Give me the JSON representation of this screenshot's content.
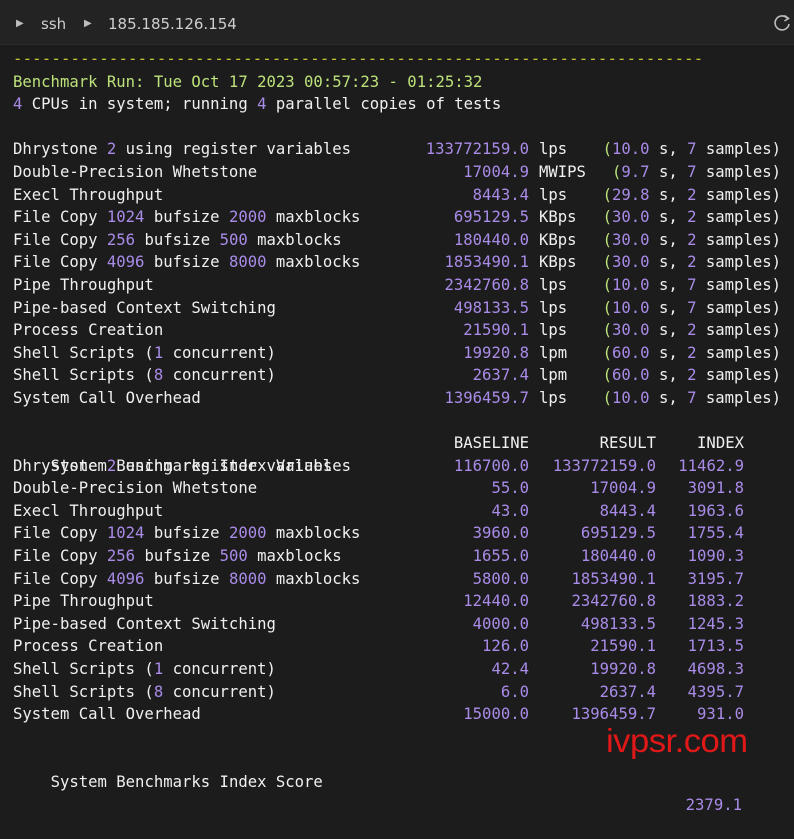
{
  "titlebar": {
    "session": "ssh",
    "host": "185.185.126.154"
  },
  "separator": "------------------------------------------------------------------------",
  "run": {
    "label": "Benchmark Run: ",
    "date": "Tue Oct 17 2023 00:57:23 - 01:25:32",
    "cpu_count": "4",
    "cpu_text_a": " CPUs in system; running ",
    "copies": "4",
    "cpu_text_b": " parallel copies of tests"
  },
  "results": [
    {
      "name_a": "Dhrystone ",
      "n1": "2",
      "name_b": " using register variables",
      "value": "133772159.0",
      "unit": "lps",
      "time": "10.0",
      "tunit": "s",
      "samples": "7"
    },
    {
      "name_a": "Double-Precision Whetstone",
      "n1": "",
      "name_b": "",
      "value": "17004.9",
      "unit": "MWIPS",
      "time": "9.7",
      "tunit": "s",
      "samples": "7"
    },
    {
      "name_a": "Execl Throughput",
      "n1": "",
      "name_b": "",
      "value": "8443.4",
      "unit": "lps",
      "time": "29.8",
      "tunit": "s",
      "samples": "2"
    },
    {
      "name_a": "File Copy ",
      "n1": "1024",
      "name_b": " bufsize ",
      "n2": "2000",
      "name_c": " maxblocks",
      "value": "695129.5",
      "unit": "KBps",
      "time": "30.0",
      "tunit": "s",
      "samples": "2"
    },
    {
      "name_a": "File Copy ",
      "n1": "256",
      "name_b": " bufsize ",
      "n2": "500",
      "name_c": " maxblocks",
      "value": "180440.0",
      "unit": "KBps",
      "time": "30.0",
      "tunit": "s",
      "samples": "2"
    },
    {
      "name_a": "File Copy ",
      "n1": "4096",
      "name_b": " bufsize ",
      "n2": "8000",
      "name_c": " maxblocks",
      "value": "1853490.1",
      "unit": "KBps",
      "time": "30.0",
      "tunit": "s",
      "samples": "2"
    },
    {
      "name_a": "Pipe Throughput",
      "n1": "",
      "name_b": "",
      "value": "2342760.8",
      "unit": "lps",
      "time": "10.0",
      "tunit": "s",
      "samples": "7"
    },
    {
      "name_a": "Pipe-based Context Switching",
      "n1": "",
      "name_b": "",
      "value": "498133.5",
      "unit": "lps",
      "time": "10.0",
      "tunit": "s",
      "samples": "7"
    },
    {
      "name_a": "Process Creation",
      "n1": "",
      "name_b": "",
      "value": "21590.1",
      "unit": "lps",
      "time": "30.0",
      "tunit": "s",
      "samples": "2"
    },
    {
      "name_a": "Shell Scripts (",
      "n1": "1",
      "name_b": " concurrent)",
      "value": "19920.8",
      "unit": "lpm",
      "time": "60.0",
      "tunit": "s",
      "samples": "2"
    },
    {
      "name_a": "Shell Scripts (",
      "n1": "8",
      "name_b": " concurrent)",
      "value": "2637.4",
      "unit": "lpm",
      "time": "60.0",
      "tunit": "s",
      "samples": "2"
    },
    {
      "name_a": "System Call Overhead",
      "n1": "",
      "name_b": "",
      "value": "1396459.7",
      "unit": "lps",
      "time": "10.0",
      "tunit": "s",
      "samples": "7"
    }
  ],
  "samples_word": "samples)",
  "index_header": {
    "title": "System Benchmarks Index Values",
    "baseline": "BASELINE",
    "result": "RESULT",
    "index": "INDEX"
  },
  "index_rows": [
    {
      "name_a": "Dhrystone ",
      "n1": "2",
      "name_b": " using register variables",
      "baseline": "116700.0",
      "result": "133772159.0",
      "index": "11462.9"
    },
    {
      "name_a": "Double-Precision Whetstone",
      "baseline": "55.0",
      "result": "17004.9",
      "index": "3091.8"
    },
    {
      "name_a": "Execl Throughput",
      "baseline": "43.0",
      "result": "8443.4",
      "index": "1963.6"
    },
    {
      "name_a": "File Copy ",
      "n1": "1024",
      "name_b": " bufsize ",
      "n2": "2000",
      "name_c": " maxblocks",
      "baseline": "3960.0",
      "result": "695129.5",
      "index": "1755.4"
    },
    {
      "name_a": "File Copy ",
      "n1": "256",
      "name_b": " bufsize ",
      "n2": "500",
      "name_c": " maxblocks",
      "baseline": "1655.0",
      "result": "180440.0",
      "index": "1090.3"
    },
    {
      "name_a": "File Copy ",
      "n1": "4096",
      "name_b": " bufsize ",
      "n2": "8000",
      "name_c": " maxblocks",
      "baseline": "5800.0",
      "result": "1853490.1",
      "index": "3195.7"
    },
    {
      "name_a": "Pipe Throughput",
      "baseline": "12440.0",
      "result": "2342760.8",
      "index": "1883.2"
    },
    {
      "name_a": "Pipe-based Context Switching",
      "baseline": "4000.0",
      "result": "498133.5",
      "index": "1245.3"
    },
    {
      "name_a": "Process Creation",
      "baseline": "126.0",
      "result": "21590.1",
      "index": "1713.5"
    },
    {
      "name_a": "Shell Scripts (",
      "n1": "1",
      "name_b": " concurrent)",
      "baseline": "42.4",
      "result": "19920.8",
      "index": "4698.3"
    },
    {
      "name_a": "Shell Scripts (",
      "n1": "8",
      "name_b": " concurrent)",
      "baseline": "6.0",
      "result": "2637.4",
      "index": "4395.7"
    },
    {
      "name_a": "System Call Overhead",
      "baseline": "15000.0",
      "result": "1396459.7",
      "index": "931.0"
    }
  ],
  "score": {
    "label": "System Benchmarks Index Score",
    "value": "2379.1"
  },
  "watermark": "ivpsr.com"
}
